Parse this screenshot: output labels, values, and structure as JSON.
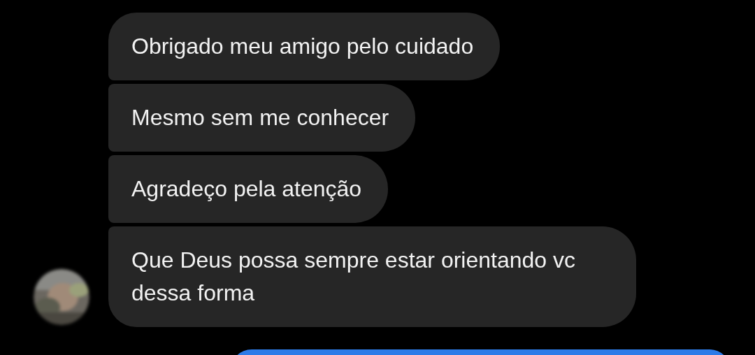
{
  "messages": [
    {
      "kind": "incoming",
      "text": "Obrigado meu amigo pelo cuidado"
    },
    {
      "kind": "incoming",
      "text": "Mesmo sem me conhecer"
    },
    {
      "kind": "incoming",
      "text": "Agradeço pela atenção"
    },
    {
      "kind": "incoming",
      "text": "Que Deus possa sempre estar orientando vc dessa forma"
    },
    {
      "kind": "outgoing"
    }
  ]
}
